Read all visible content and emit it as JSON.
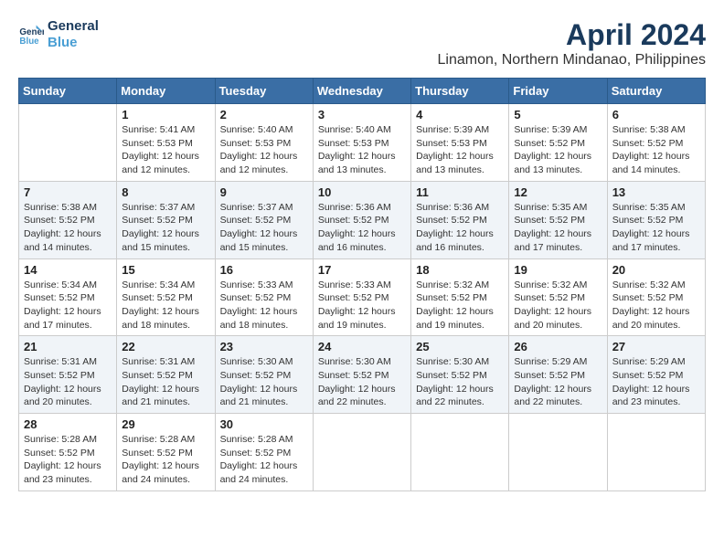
{
  "header": {
    "logo_line1": "General",
    "logo_line2": "Blue",
    "month": "April 2024",
    "location": "Linamon, Northern Mindanao, Philippines"
  },
  "weekdays": [
    "Sunday",
    "Monday",
    "Tuesday",
    "Wednesday",
    "Thursday",
    "Friday",
    "Saturday"
  ],
  "weeks": [
    [
      {
        "day": "",
        "info": ""
      },
      {
        "day": "1",
        "info": "Sunrise: 5:41 AM\nSunset: 5:53 PM\nDaylight: 12 hours\nand 12 minutes."
      },
      {
        "day": "2",
        "info": "Sunrise: 5:40 AM\nSunset: 5:53 PM\nDaylight: 12 hours\nand 12 minutes."
      },
      {
        "day": "3",
        "info": "Sunrise: 5:40 AM\nSunset: 5:53 PM\nDaylight: 12 hours\nand 13 minutes."
      },
      {
        "day": "4",
        "info": "Sunrise: 5:39 AM\nSunset: 5:53 PM\nDaylight: 12 hours\nand 13 minutes."
      },
      {
        "day": "5",
        "info": "Sunrise: 5:39 AM\nSunset: 5:52 PM\nDaylight: 12 hours\nand 13 minutes."
      },
      {
        "day": "6",
        "info": "Sunrise: 5:38 AM\nSunset: 5:52 PM\nDaylight: 12 hours\nand 14 minutes."
      }
    ],
    [
      {
        "day": "7",
        "info": "Sunrise: 5:38 AM\nSunset: 5:52 PM\nDaylight: 12 hours\nand 14 minutes."
      },
      {
        "day": "8",
        "info": "Sunrise: 5:37 AM\nSunset: 5:52 PM\nDaylight: 12 hours\nand 15 minutes."
      },
      {
        "day": "9",
        "info": "Sunrise: 5:37 AM\nSunset: 5:52 PM\nDaylight: 12 hours\nand 15 minutes."
      },
      {
        "day": "10",
        "info": "Sunrise: 5:36 AM\nSunset: 5:52 PM\nDaylight: 12 hours\nand 16 minutes."
      },
      {
        "day": "11",
        "info": "Sunrise: 5:36 AM\nSunset: 5:52 PM\nDaylight: 12 hours\nand 16 minutes."
      },
      {
        "day": "12",
        "info": "Sunrise: 5:35 AM\nSunset: 5:52 PM\nDaylight: 12 hours\nand 17 minutes."
      },
      {
        "day": "13",
        "info": "Sunrise: 5:35 AM\nSunset: 5:52 PM\nDaylight: 12 hours\nand 17 minutes."
      }
    ],
    [
      {
        "day": "14",
        "info": "Sunrise: 5:34 AM\nSunset: 5:52 PM\nDaylight: 12 hours\nand 17 minutes."
      },
      {
        "day": "15",
        "info": "Sunrise: 5:34 AM\nSunset: 5:52 PM\nDaylight: 12 hours\nand 18 minutes."
      },
      {
        "day": "16",
        "info": "Sunrise: 5:33 AM\nSunset: 5:52 PM\nDaylight: 12 hours\nand 18 minutes."
      },
      {
        "day": "17",
        "info": "Sunrise: 5:33 AM\nSunset: 5:52 PM\nDaylight: 12 hours\nand 19 minutes."
      },
      {
        "day": "18",
        "info": "Sunrise: 5:32 AM\nSunset: 5:52 PM\nDaylight: 12 hours\nand 19 minutes."
      },
      {
        "day": "19",
        "info": "Sunrise: 5:32 AM\nSunset: 5:52 PM\nDaylight: 12 hours\nand 20 minutes."
      },
      {
        "day": "20",
        "info": "Sunrise: 5:32 AM\nSunset: 5:52 PM\nDaylight: 12 hours\nand 20 minutes."
      }
    ],
    [
      {
        "day": "21",
        "info": "Sunrise: 5:31 AM\nSunset: 5:52 PM\nDaylight: 12 hours\nand 20 minutes."
      },
      {
        "day": "22",
        "info": "Sunrise: 5:31 AM\nSunset: 5:52 PM\nDaylight: 12 hours\nand 21 minutes."
      },
      {
        "day": "23",
        "info": "Sunrise: 5:30 AM\nSunset: 5:52 PM\nDaylight: 12 hours\nand 21 minutes."
      },
      {
        "day": "24",
        "info": "Sunrise: 5:30 AM\nSunset: 5:52 PM\nDaylight: 12 hours\nand 22 minutes."
      },
      {
        "day": "25",
        "info": "Sunrise: 5:30 AM\nSunset: 5:52 PM\nDaylight: 12 hours\nand 22 minutes."
      },
      {
        "day": "26",
        "info": "Sunrise: 5:29 AM\nSunset: 5:52 PM\nDaylight: 12 hours\nand 22 minutes."
      },
      {
        "day": "27",
        "info": "Sunrise: 5:29 AM\nSunset: 5:52 PM\nDaylight: 12 hours\nand 23 minutes."
      }
    ],
    [
      {
        "day": "28",
        "info": "Sunrise: 5:28 AM\nSunset: 5:52 PM\nDaylight: 12 hours\nand 23 minutes."
      },
      {
        "day": "29",
        "info": "Sunrise: 5:28 AM\nSunset: 5:52 PM\nDaylight: 12 hours\nand 24 minutes."
      },
      {
        "day": "30",
        "info": "Sunrise: 5:28 AM\nSunset: 5:52 PM\nDaylight: 12 hours\nand 24 minutes."
      },
      {
        "day": "",
        "info": ""
      },
      {
        "day": "",
        "info": ""
      },
      {
        "day": "",
        "info": ""
      },
      {
        "day": "",
        "info": ""
      }
    ]
  ]
}
